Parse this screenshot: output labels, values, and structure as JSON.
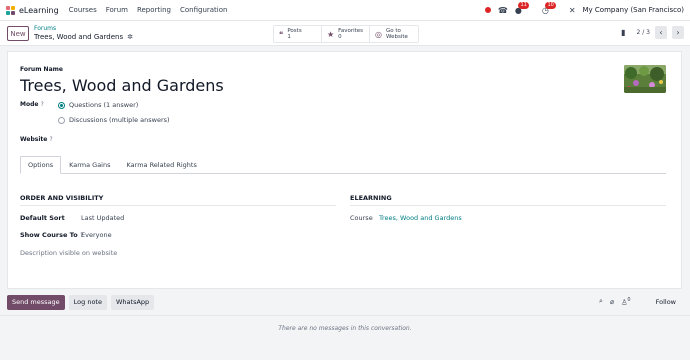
{
  "topbar": {
    "app_name": "eLearning",
    "menu": [
      "Courses",
      "Forum",
      "Reporting",
      "Configuration"
    ],
    "chat_badge": "11",
    "activity_badge": "10",
    "company": "My Company (San Francisco)"
  },
  "control": {
    "new_label": "New",
    "breadcrumb_parent": "Forums",
    "breadcrumb_current": "Trees, Wood and Gardens",
    "stats": [
      {
        "icon": "comments-icon",
        "label": "Posts",
        "value": "1"
      },
      {
        "icon": "star-icon",
        "label": "Favorites",
        "value": "0"
      },
      {
        "icon": "globe-icon",
        "label": "Go to",
        "value": "Website"
      }
    ],
    "pager": "2 / 3"
  },
  "form": {
    "forum_name_label": "Forum Name",
    "forum_name": "Trees, Wood and Gardens",
    "mode_label": "Mode",
    "mode_options": [
      "Questions (1 answer)",
      "Discussions (multiple answers)"
    ],
    "mode_selected": 0,
    "website_label": "Website",
    "tabs": [
      "Options",
      "Karma Gains",
      "Karma Related Rights"
    ],
    "active_tab": 0,
    "order_section": "ORDER AND VISIBILITY",
    "default_sort_label": "Default Sort",
    "default_sort_value": "Last Updated",
    "show_course_label": "Show Course To",
    "show_course_value": "Everyone",
    "description_placeholder": "Description visible on website",
    "elearning_section": "ELEARNING",
    "course_label": "Course",
    "course_value": "Trees, Wood and Gardens"
  },
  "chatter": {
    "send_message": "Send message",
    "log_note": "Log note",
    "whatsapp": "WhatsApp",
    "followers_count": "0",
    "follow_label": "Follow",
    "empty_text": "There are no messages in this conversation."
  },
  "colors": {
    "brand": "#714b67",
    "link": "#017e84",
    "badge": "#dc2626"
  }
}
